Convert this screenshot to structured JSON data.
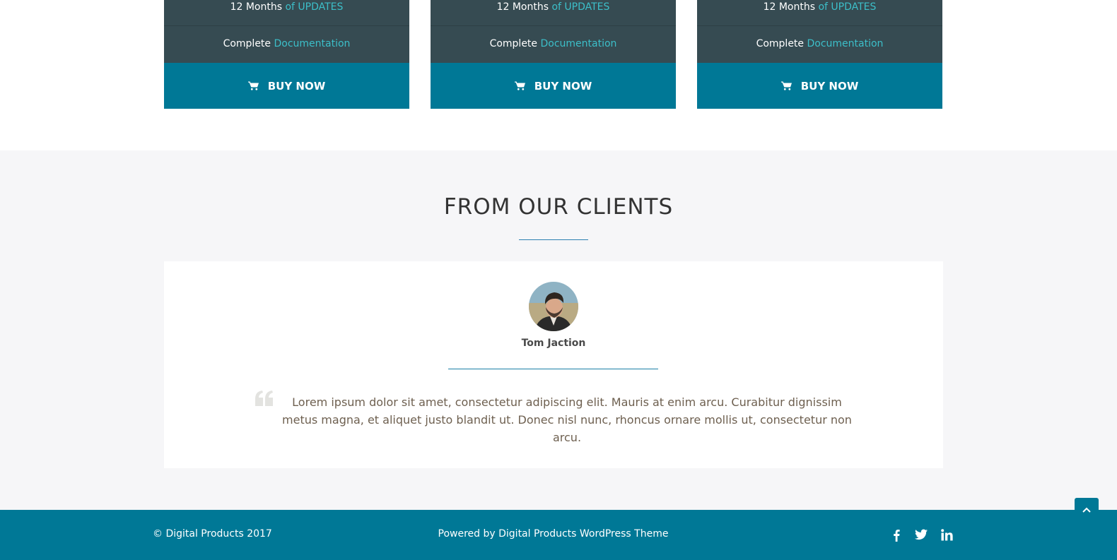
{
  "pricing": {
    "cards": [
      {
        "updates_prefix": "12 Months",
        "updates_highlight": "of UPDATES",
        "docs_prefix": "Complete",
        "docs_highlight": "Documentation",
        "button_label": "BUY NOW"
      },
      {
        "updates_prefix": "12 Months",
        "updates_highlight": "of UPDATES",
        "docs_prefix": "Complete",
        "docs_highlight": "Documentation",
        "button_label": "BUY NOW"
      },
      {
        "updates_prefix": "12 Months",
        "updates_highlight": "of UPDATES",
        "docs_prefix": "Complete",
        "docs_highlight": "Documentation",
        "button_label": "BUY NOW"
      }
    ]
  },
  "clients": {
    "title": "FROM OUR CLIENTS",
    "testimonial": {
      "name": "Tom Jaction",
      "quote": "Lorem ipsum dolor sit amet, consectetur adipiscing elit. Mauris at enim arcu. Curabitur dignissim metus magna, et aliquet justo blandit ut. Donec nisl nunc, rhoncus ornare mollis ut, consectetur non arcu."
    }
  },
  "footer": {
    "copyright": "© Digital Products 2017",
    "powered_by": "Powered by Digital Products WordPress Theme",
    "social": [
      "facebook-icon",
      "twitter-icon",
      "linkedin-icon"
    ]
  },
  "colors": {
    "primary": "#007896",
    "card_dark": "#364b52",
    "accent_text": "#3cbfc9",
    "section_bg": "#f6f6f8"
  },
  "icons": {
    "cart": "cart-icon",
    "quote": "quote-icon",
    "back_to_top": "chevron-up-icon"
  }
}
